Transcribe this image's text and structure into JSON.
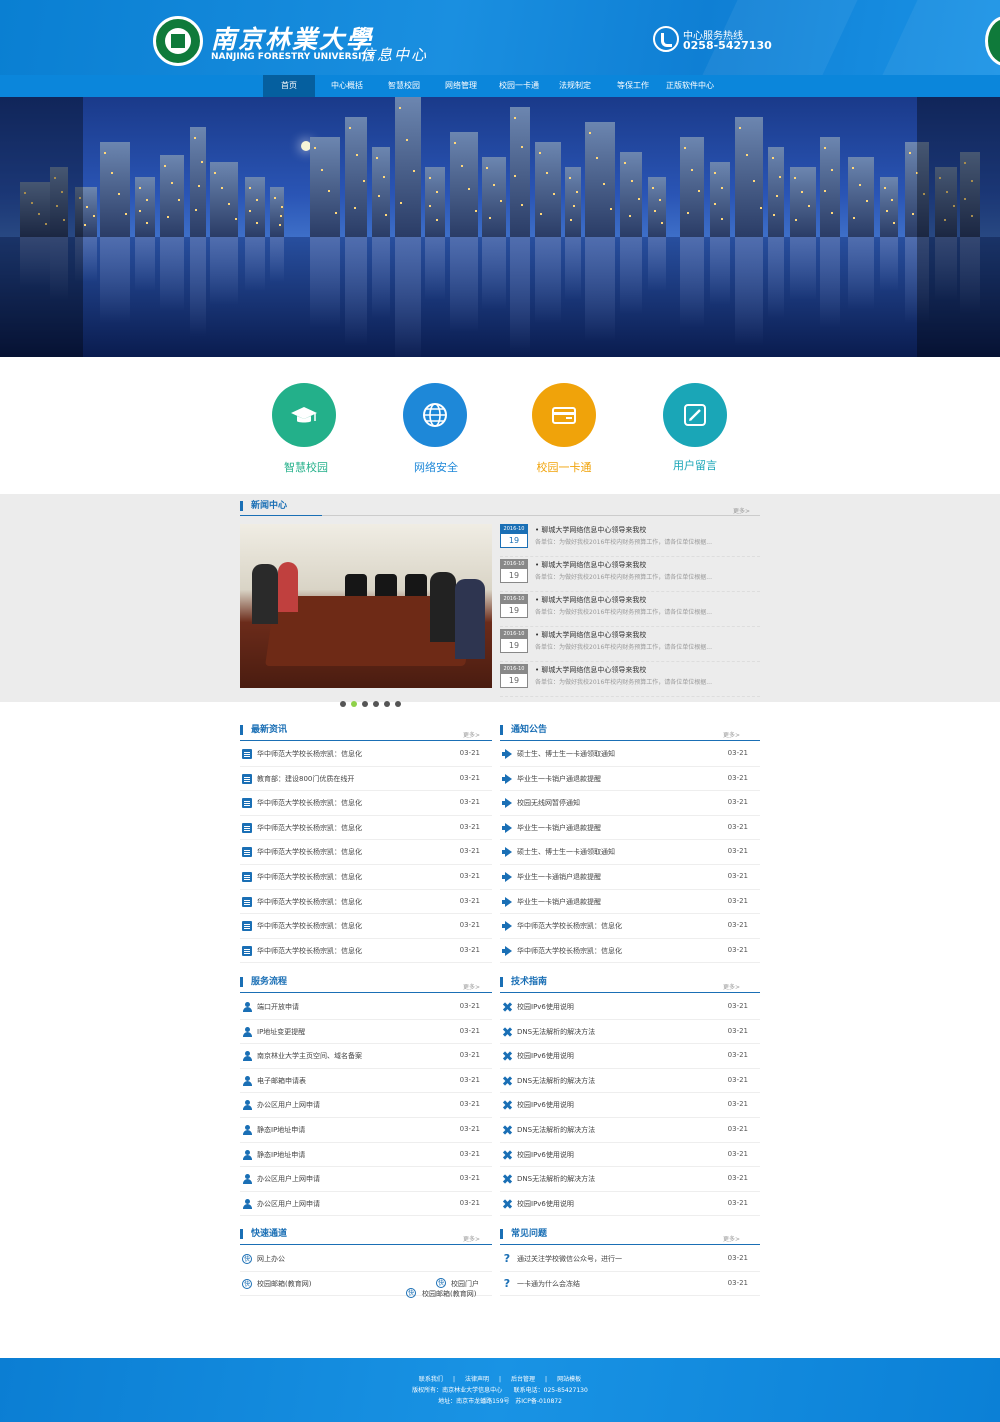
{
  "header": {
    "logo_cn": "南京林業大學",
    "logo_en": "NANJING FORESTRY UNIVERSITY",
    "logo_sub": "信息中心",
    "hotline_label": "中心服务热线",
    "hotline_number": "0258-5427130"
  },
  "nav": {
    "items": [
      "首页",
      "中心概括",
      "智慧校园",
      "网络管理",
      "校园一卡通",
      "法规制定",
      "等保工作",
      "正版软件中心"
    ],
    "active_index": 0
  },
  "banner": {
    "slides": 4,
    "active_slide": 1
  },
  "quick_links": [
    {
      "label": "智慧校园",
      "icon": "graduation-cap-icon",
      "color": "#23b08a"
    },
    {
      "label": "网络安全",
      "icon": "globe-icon",
      "color": "#1e88d8"
    },
    {
      "label": "校园一卡通",
      "icon": "card-icon",
      "color": "#f0a30a"
    },
    {
      "label": "用户留言",
      "icon": "edit-icon",
      "color": "#1aa6b7"
    }
  ],
  "news_center": {
    "title": "新闻中心",
    "more": "更多>",
    "slides": 6,
    "active_slide": 1,
    "items": [
      {
        "ym": "2016-10",
        "day": "19",
        "title": "• 聊城大学网络信息中心领导来我校",
        "desc": "各单位：为做好我校2016年校内财务预算工作，请各位单位根据..."
      },
      {
        "ym": "2016-10",
        "day": "19",
        "title": "• 聊城大学网络信息中心领导来我校",
        "desc": "各单位：为做好我校2016年校内财务预算工作，请各位单位根据..."
      },
      {
        "ym": "2016-10",
        "day": "19",
        "title": "• 聊城大学网络信息中心领导来我校",
        "desc": "各单位：为做好我校2016年校内财务预算工作，请各位单位根据..."
      },
      {
        "ym": "2016-10",
        "day": "19",
        "title": "• 聊城大学网络信息中心领导来我校",
        "desc": "各单位：为做好我校2016年校内财务预算工作，请各位单位根据..."
      },
      {
        "ym": "2016-10",
        "day": "19",
        "title": "• 聊城大学网络信息中心领导来我校",
        "desc": "各单位：为做好我校2016年校内财务预算工作，请各位单位根据..."
      }
    ]
  },
  "latest": {
    "title": "最新资讯",
    "more": "更多>",
    "items": [
      {
        "text": "华中师范大学校长杨宗凯：信息化",
        "date": "03-21"
      },
      {
        "text": "教育部：建设800门优质在线开",
        "date": "03-21"
      },
      {
        "text": "华中师范大学校长杨宗凯：信息化",
        "date": "03-21"
      },
      {
        "text": "华中师范大学校长杨宗凯：信息化",
        "date": "03-21"
      },
      {
        "text": "华中师范大学校长杨宗凯：信息化",
        "date": "03-21"
      },
      {
        "text": "华中师范大学校长杨宗凯：信息化",
        "date": "03-21"
      },
      {
        "text": "华中师范大学校长杨宗凯：信息化",
        "date": "03-21"
      },
      {
        "text": "华中师范大学校长杨宗凯：信息化",
        "date": "03-21"
      },
      {
        "text": "华中师范大学校长杨宗凯：信息化",
        "date": "03-21"
      }
    ]
  },
  "notices": {
    "title": "通知公告",
    "more": "更多>",
    "items": [
      {
        "text": "硕士生、博士生一卡通领取通知",
        "date": "03-21"
      },
      {
        "text": "毕业生一卡销户通退款提醒",
        "date": "03-21"
      },
      {
        "text": "校园无线网暂停通知",
        "date": "03-21"
      },
      {
        "text": "毕业生一卡销户通退款提醒",
        "date": "03-21"
      },
      {
        "text": "硕士生、博士生一卡通领取通知",
        "date": "03-21"
      },
      {
        "text": "毕业生一卡通销户退款提醒",
        "date": "03-21"
      },
      {
        "text": "毕业生一卡销户通退款提醒",
        "date": "03-21"
      },
      {
        "text": "华中师范大学校长杨宗凯：信息化",
        "date": "03-21"
      },
      {
        "text": "华中师范大学校长杨宗凯：信息化",
        "date": "03-21"
      }
    ]
  },
  "services": {
    "title": "服务流程",
    "more": "更多>",
    "items": [
      {
        "text": "端口开放申请",
        "date": "03-21"
      },
      {
        "text": "IP地址变更提醒",
        "date": "03-21"
      },
      {
        "text": "南京林业大学主页空间、域名备案",
        "date": "03-21"
      },
      {
        "text": "电子邮箱申请表",
        "date": "03-21"
      },
      {
        "text": "办公区用户上网申请",
        "date": "03-21"
      },
      {
        "text": "静态IP地址申请",
        "date": "03-21"
      },
      {
        "text": "静态IP地址申请",
        "date": "03-21"
      },
      {
        "text": "办公区用户上网申请",
        "date": "03-21"
      },
      {
        "text": "办公区用户上网申请",
        "date": "03-21"
      }
    ]
  },
  "tech": {
    "title": "技术指南",
    "more": "更多>",
    "items": [
      {
        "text": "校园IPv6使用说明",
        "date": "03-21"
      },
      {
        "text": "DNS无法解析的解决方法",
        "date": "03-21"
      },
      {
        "text": "校园IPv6使用说明",
        "date": "03-21"
      },
      {
        "text": "DNS无法解析的解决方法",
        "date": "03-21"
      },
      {
        "text": "校园IPv6使用说明",
        "date": "03-21"
      },
      {
        "text": "DNS无法解析的解决方法",
        "date": "03-21"
      },
      {
        "text": "校园IPv6使用说明",
        "date": "03-21"
      },
      {
        "text": "DNS无法解析的解决方法",
        "date": "03-21"
      },
      {
        "text": "校园IPv6使用说明",
        "date": "03-21"
      }
    ]
  },
  "quick_channel": {
    "title": "快速通道",
    "more": "更多>",
    "badge": "快",
    "items": [
      "网上办公",
      "校园邮箱(教育网)"
    ],
    "floating": [
      "校园门户",
      "校园邮箱(教育网)"
    ]
  },
  "faq": {
    "title": "常见问题",
    "more": "更多>",
    "items": [
      {
        "text": "通过关注学校微信公众号，进行一",
        "date": "03-21"
      },
      {
        "text": "一卡通为什么会冻结",
        "date": "03-21"
      }
    ]
  },
  "footer": {
    "links": [
      "联系我们",
      "|",
      "法律声明",
      "|",
      "后台管理",
      "|",
      "网站模板"
    ],
    "copyright": "版权所有：南京林业大学信息中心",
    "phone": "联系电话：025-85427130",
    "address": "地址：南京市龙蟠路159号",
    "icp": "苏ICP备-010872"
  }
}
